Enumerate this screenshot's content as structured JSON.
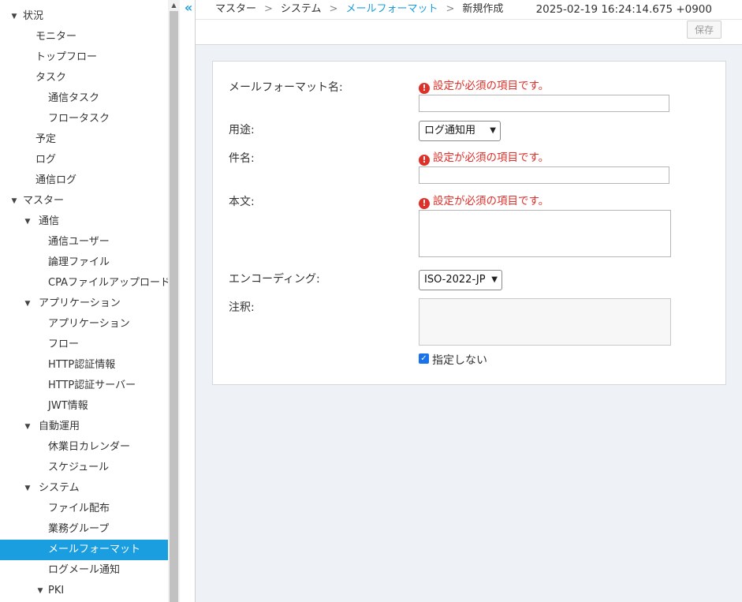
{
  "sidebar": {
    "items": [
      {
        "label": "状況",
        "toggle": "▼"
      },
      {
        "label": "モニター"
      },
      {
        "label": "トップフロー"
      },
      {
        "label": "タスク"
      },
      {
        "label": "通信タスク"
      },
      {
        "label": "フロータスク"
      },
      {
        "label": "予定"
      },
      {
        "label": "ログ"
      },
      {
        "label": "通信ログ"
      },
      {
        "label": "マスター",
        "toggle": "▼"
      },
      {
        "label": "通信",
        "toggle": "▼"
      },
      {
        "label": "通信ユーザー"
      },
      {
        "label": "論理ファイル"
      },
      {
        "label": "CPAファイルアップロード"
      },
      {
        "label": "アプリケーション",
        "toggle": "▼"
      },
      {
        "label": "アプリケーション"
      },
      {
        "label": "フロー"
      },
      {
        "label": "HTTP認証情報"
      },
      {
        "label": "HTTP認証サーバー"
      },
      {
        "label": "JWT情報"
      },
      {
        "label": "自動運用",
        "toggle": "▼"
      },
      {
        "label": "休業日カレンダー"
      },
      {
        "label": "スケジュール"
      },
      {
        "label": "システム",
        "toggle": "▼"
      },
      {
        "label": "ファイル配布"
      },
      {
        "label": "業務グループ"
      },
      {
        "label": "メールフォーマット",
        "selected": true
      },
      {
        "label": "ログメール通知"
      },
      {
        "label": "PKI",
        "toggle": "▼"
      }
    ],
    "collapse_icon": "double-chevron-left-icon"
  },
  "header": {
    "breadcrumb": [
      "マスター",
      "システム",
      "メールフォーマット",
      "新規作成"
    ],
    "separator": ">",
    "timestamp": "2025-02-19 16:24:14.675 +0900"
  },
  "toolbar": {
    "save_label": "保存"
  },
  "form": {
    "mail_format_name": {
      "label": "メールフォーマット名:",
      "error": "設定が必須の項目です。",
      "value": ""
    },
    "usage": {
      "label": "用途:",
      "value": "ログ通知用"
    },
    "subject": {
      "label": "件名:",
      "error": "設定が必須の項目です。",
      "value": ""
    },
    "body": {
      "label": "本文:",
      "error": "設定が必須の項目です。",
      "value": ""
    },
    "encoding": {
      "label": "エンコーディング:",
      "value": "ISO-2022-JP"
    },
    "note": {
      "label": "注釈:",
      "value": "",
      "checkbox_label": "指定しない",
      "checkbox_checked": true
    }
  },
  "colors": {
    "accent": "#1a9ee0",
    "error": "#e0302a",
    "content_bg": "#eef1f5"
  }
}
